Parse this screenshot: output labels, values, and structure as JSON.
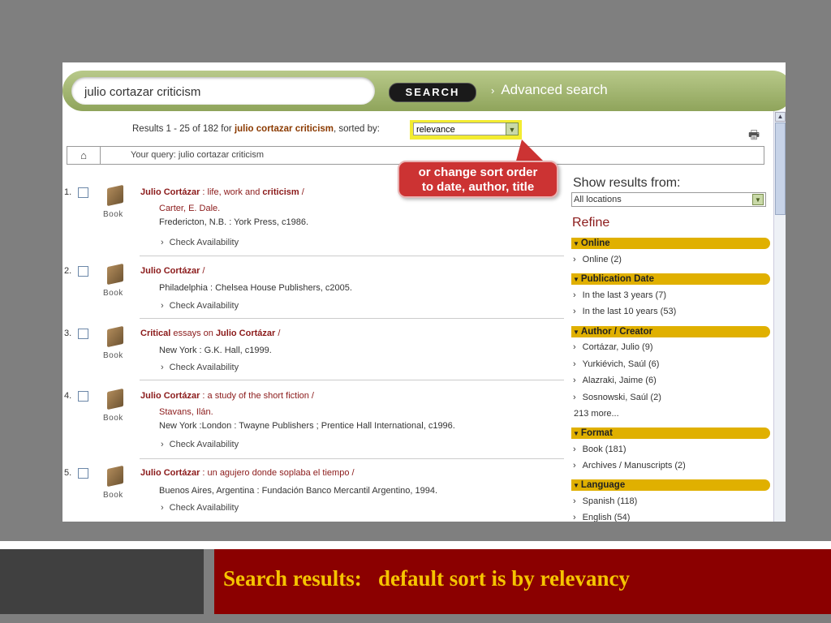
{
  "search": {
    "query": "julio cortazar criticism",
    "button_label": "SEARCH",
    "advanced_label": "Advanced search"
  },
  "results_header": {
    "prefix": "Results 1 - 25 of 182 for",
    "query": "julio cortazar criticism",
    "suffix": ", sorted by:",
    "sort_value": "relevance"
  },
  "query_bar": {
    "text": "Your query: julio cortazar criticism"
  },
  "callout": {
    "line1": "or change sort order",
    "line2": "to date, author, title"
  },
  "results": [
    {
      "num": "1.",
      "type": "Book",
      "title_main": "Julio Cortázar",
      "title_rest": " : life, work and ",
      "title_bold2": "criticism",
      "title_end": " /",
      "author": "Carter, E. Dale.",
      "pub": "Fredericton, N.B. : York Press, c1986.",
      "check": "Check Availability"
    },
    {
      "num": "2.",
      "type": "Book",
      "title_main": "Julio Cortázar",
      "title_rest": " /",
      "pub": "Philadelphia : Chelsea House Publishers, c2005.",
      "check": "Check Availability"
    },
    {
      "num": "3.",
      "type": "Book",
      "title_pre": "Critical",
      "title_rest": " essays on ",
      "title_main": "Julio Cortázar",
      "title_end": " /",
      "pub": "New York : G.K. Hall, c1999.",
      "check": "Check Availability"
    },
    {
      "num": "4.",
      "type": "Book",
      "title_main": "Julio Cortázar",
      "title_rest": " : a study of the short fiction /",
      "author": "Stavans, Ilán.",
      "pub": "New York :London : Twayne Publishers ; Prentice Hall International, c1996.",
      "check": "Check Availability"
    },
    {
      "num": "5.",
      "type": "Book",
      "title_main": "Julio Cortázar",
      "title_rest": " : un agujero donde soplaba el tiempo /",
      "pub": "Buenos Aires, Argentina : Fundación Banco Mercantil Argentino, 1994.",
      "check": "Check Availability"
    }
  ],
  "sidebar": {
    "show_results_label": "Show results from:",
    "location_value": "All locations",
    "refine_label": "Refine",
    "facets": [
      {
        "title": "Online",
        "items": [
          "Online (2)"
        ]
      },
      {
        "title": "Publication Date",
        "items": [
          "In the last 3 years (7)",
          "In the last 10 years (53)"
        ]
      },
      {
        "title": "Author / Creator",
        "items": [
          "Cortázar, Julio (9)",
          "Yurkiévich, Saúl (6)",
          "Alazraki, Jaime (6)",
          "Sosnowski, Saúl (2)"
        ],
        "more": "213 more..."
      },
      {
        "title": "Format",
        "items": [
          "Book (181)",
          "Archives / Manuscripts (2)"
        ]
      },
      {
        "title": "Language",
        "items": [
          "Spanish (118)",
          "English (54)"
        ]
      }
    ]
  },
  "caption": "Search results:   default sort is by relevancy",
  "colors": {
    "caption_text": "#f5c400",
    "caption_bg": "#8b0000",
    "facet_header": "#e0b000",
    "title_link": "#8b1a1a"
  },
  "icons": [
    "home-icon",
    "print-icon",
    "book-icon",
    "chevron-right-icon",
    "triangle-down-icon",
    "dropdown-arrow-icon"
  ]
}
